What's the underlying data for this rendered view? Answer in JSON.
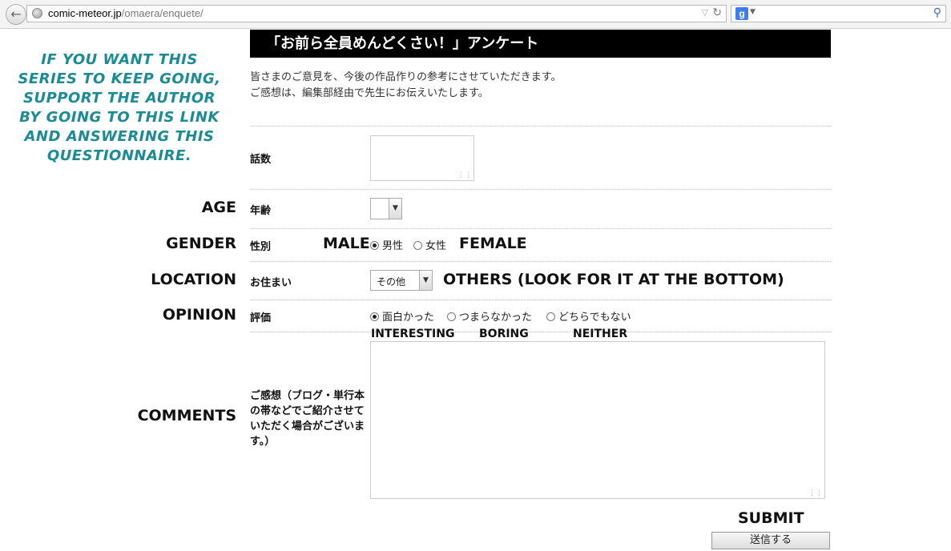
{
  "browser": {
    "url_host": "comic-meteor.jp",
    "url_path": "/omaera/enquete/",
    "search_engine_label": "g"
  },
  "note": "If you want this series to keep going, support the author by going to this link and answering this questionnaire.",
  "page": {
    "title": "「お前ら全員めんどくさい！」アンケート",
    "intro_line1": "皆さまのご意見を、今後の作品作りの参考にさせていただきます。",
    "intro_line2": "ご感想は、編集部経由で先生にお伝えいたします。"
  },
  "form": {
    "episode_label": "話数",
    "age_label": "年齢",
    "gender_label": "性別",
    "gender_male": "男性",
    "gender_female": "女性",
    "location_label": "お住まい",
    "location_value": "その他",
    "rating_label": "評価",
    "rating_opt1": "面白かった",
    "rating_opt2": "つまらなかった",
    "rating_opt3": "どちらでもない",
    "comments_label": "ご感想（ブログ・単行本の帯などでご紹介させていただく場合がございます。）",
    "submit_label": "送信する"
  },
  "translations": {
    "age": "AGE",
    "gender": "GENDER",
    "male": "MALE",
    "female": "FEMALE",
    "location": "LOCATION",
    "others": "OTHERS (LOOK FOR IT AT THE BOTTOM)",
    "opinion": "OPINION",
    "interesting": "INTERESTING",
    "boring": "BORING",
    "neither": "NEITHER",
    "comments": "COMMENTS",
    "submit": "SUBMIT"
  },
  "colors": {
    "note_text": "#1b8b94",
    "header_bg": "#000000"
  }
}
